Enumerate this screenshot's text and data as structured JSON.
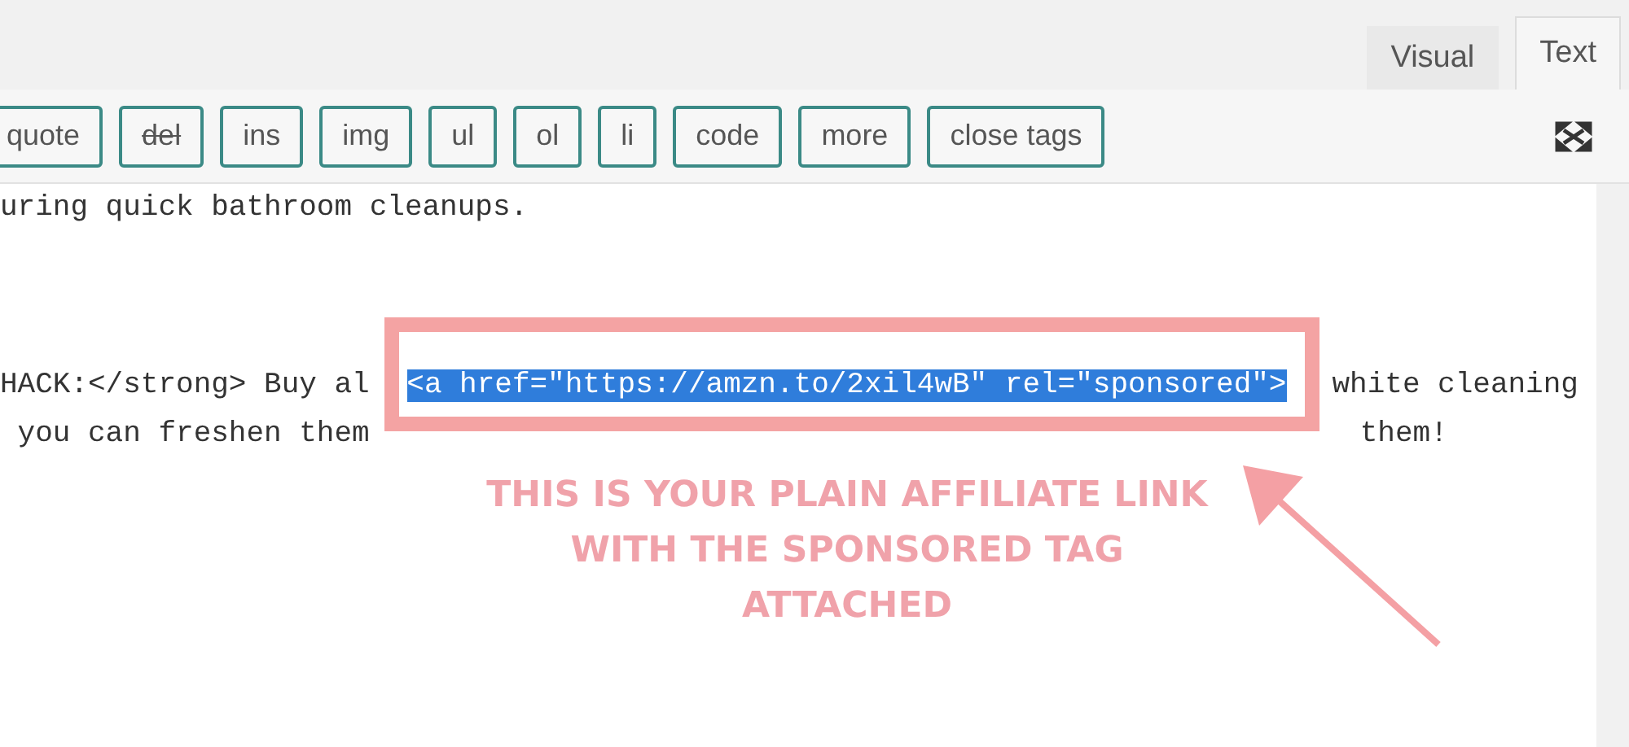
{
  "tabs": [
    {
      "label": "Visual",
      "selected": false
    },
    {
      "label": "Text",
      "selected": true
    }
  ],
  "toolbar": {
    "buttons": [
      {
        "label": "quote",
        "kind": "plain"
      },
      {
        "label": "del",
        "kind": "strike"
      },
      {
        "label": "ins",
        "kind": "plain"
      },
      {
        "label": "img",
        "kind": "plain"
      },
      {
        "label": "ul",
        "kind": "plain"
      },
      {
        "label": "ol",
        "kind": "plain"
      },
      {
        "label": "li",
        "kind": "plain"
      },
      {
        "label": "code",
        "kind": "plain"
      },
      {
        "label": "more",
        "kind": "plain"
      },
      {
        "label": "close tags",
        "kind": "plain"
      }
    ]
  },
  "editor": {
    "paragraphs": [
      {
        "lines": [
          {
            "segments": [
              {
                "text": "uring quick bathroom cleanups.",
                "selected": false
              }
            ]
          }
        ]
      },
      {
        "lines": [
          {
            "segments": [
              {
                "text": "HACK:</strong> Buy al ",
                "selected": false
              },
              {
                "text": "<a href=\"https://amzn.to/2xil4wB\" rel=\"sponsored\">",
                "selected": true
              },
              {
                "text": "white cleaning",
                "selected": false
              }
            ]
          },
          {
            "segments": [
              {
                "text": " you can freshen them",
                "selected": false
              },
              {
                "text": "them!",
                "selected": false,
                "kind": "after_gap"
              }
            ]
          }
        ]
      }
    ]
  },
  "callout": {
    "lines": [
      "THIS IS YOUR PLAIN AFFILIATE LINK",
      "WITH THE SPONSORED TAG",
      "ATTACHED"
    ]
  }
}
